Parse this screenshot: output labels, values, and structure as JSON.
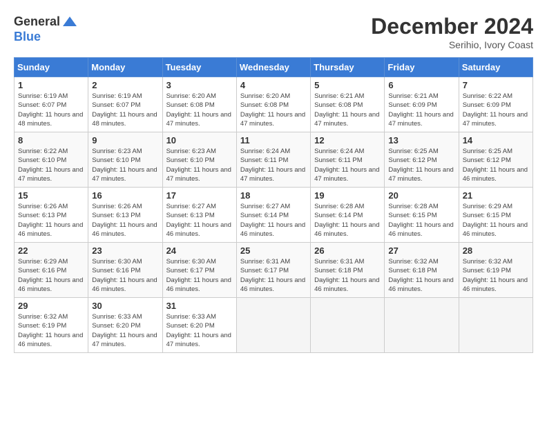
{
  "logo": {
    "general": "General",
    "blue": "Blue"
  },
  "title": "December 2024",
  "location": "Serihio, Ivory Coast",
  "days_of_week": [
    "Sunday",
    "Monday",
    "Tuesday",
    "Wednesday",
    "Thursday",
    "Friday",
    "Saturday"
  ],
  "weeks": [
    [
      {
        "day": "1",
        "sunrise": "6:19 AM",
        "sunset": "6:07 PM",
        "daylight": "11 hours and 48 minutes."
      },
      {
        "day": "2",
        "sunrise": "6:19 AM",
        "sunset": "6:07 PM",
        "daylight": "11 hours and 48 minutes."
      },
      {
        "day": "3",
        "sunrise": "6:20 AM",
        "sunset": "6:08 PM",
        "daylight": "11 hours and 47 minutes."
      },
      {
        "day": "4",
        "sunrise": "6:20 AM",
        "sunset": "6:08 PM",
        "daylight": "11 hours and 47 minutes."
      },
      {
        "day": "5",
        "sunrise": "6:21 AM",
        "sunset": "6:08 PM",
        "daylight": "11 hours and 47 minutes."
      },
      {
        "day": "6",
        "sunrise": "6:21 AM",
        "sunset": "6:09 PM",
        "daylight": "11 hours and 47 minutes."
      },
      {
        "day": "7",
        "sunrise": "6:22 AM",
        "sunset": "6:09 PM",
        "daylight": "11 hours and 47 minutes."
      }
    ],
    [
      {
        "day": "8",
        "sunrise": "6:22 AM",
        "sunset": "6:10 PM",
        "daylight": "11 hours and 47 minutes."
      },
      {
        "day": "9",
        "sunrise": "6:23 AM",
        "sunset": "6:10 PM",
        "daylight": "11 hours and 47 minutes."
      },
      {
        "day": "10",
        "sunrise": "6:23 AM",
        "sunset": "6:10 PM",
        "daylight": "11 hours and 47 minutes."
      },
      {
        "day": "11",
        "sunrise": "6:24 AM",
        "sunset": "6:11 PM",
        "daylight": "11 hours and 47 minutes."
      },
      {
        "day": "12",
        "sunrise": "6:24 AM",
        "sunset": "6:11 PM",
        "daylight": "11 hours and 47 minutes."
      },
      {
        "day": "13",
        "sunrise": "6:25 AM",
        "sunset": "6:12 PM",
        "daylight": "11 hours and 47 minutes."
      },
      {
        "day": "14",
        "sunrise": "6:25 AM",
        "sunset": "6:12 PM",
        "daylight": "11 hours and 46 minutes."
      }
    ],
    [
      {
        "day": "15",
        "sunrise": "6:26 AM",
        "sunset": "6:13 PM",
        "daylight": "11 hours and 46 minutes."
      },
      {
        "day": "16",
        "sunrise": "6:26 AM",
        "sunset": "6:13 PM",
        "daylight": "11 hours and 46 minutes."
      },
      {
        "day": "17",
        "sunrise": "6:27 AM",
        "sunset": "6:13 PM",
        "daylight": "11 hours and 46 minutes."
      },
      {
        "day": "18",
        "sunrise": "6:27 AM",
        "sunset": "6:14 PM",
        "daylight": "11 hours and 46 minutes."
      },
      {
        "day": "19",
        "sunrise": "6:28 AM",
        "sunset": "6:14 PM",
        "daylight": "11 hours and 46 minutes."
      },
      {
        "day": "20",
        "sunrise": "6:28 AM",
        "sunset": "6:15 PM",
        "daylight": "11 hours and 46 minutes."
      },
      {
        "day": "21",
        "sunrise": "6:29 AM",
        "sunset": "6:15 PM",
        "daylight": "11 hours and 46 minutes."
      }
    ],
    [
      {
        "day": "22",
        "sunrise": "6:29 AM",
        "sunset": "6:16 PM",
        "daylight": "11 hours and 46 minutes."
      },
      {
        "day": "23",
        "sunrise": "6:30 AM",
        "sunset": "6:16 PM",
        "daylight": "11 hours and 46 minutes."
      },
      {
        "day": "24",
        "sunrise": "6:30 AM",
        "sunset": "6:17 PM",
        "daylight": "11 hours and 46 minutes."
      },
      {
        "day": "25",
        "sunrise": "6:31 AM",
        "sunset": "6:17 PM",
        "daylight": "11 hours and 46 minutes."
      },
      {
        "day": "26",
        "sunrise": "6:31 AM",
        "sunset": "6:18 PM",
        "daylight": "11 hours and 46 minutes."
      },
      {
        "day": "27",
        "sunrise": "6:32 AM",
        "sunset": "6:18 PM",
        "daylight": "11 hours and 46 minutes."
      },
      {
        "day": "28",
        "sunrise": "6:32 AM",
        "sunset": "6:19 PM",
        "daylight": "11 hours and 46 minutes."
      }
    ],
    [
      {
        "day": "29",
        "sunrise": "6:32 AM",
        "sunset": "6:19 PM",
        "daylight": "11 hours and 46 minutes."
      },
      {
        "day": "30",
        "sunrise": "6:33 AM",
        "sunset": "6:20 PM",
        "daylight": "11 hours and 47 minutes."
      },
      {
        "day": "31",
        "sunrise": "6:33 AM",
        "sunset": "6:20 PM",
        "daylight": "11 hours and 47 minutes."
      },
      null,
      null,
      null,
      null
    ]
  ]
}
